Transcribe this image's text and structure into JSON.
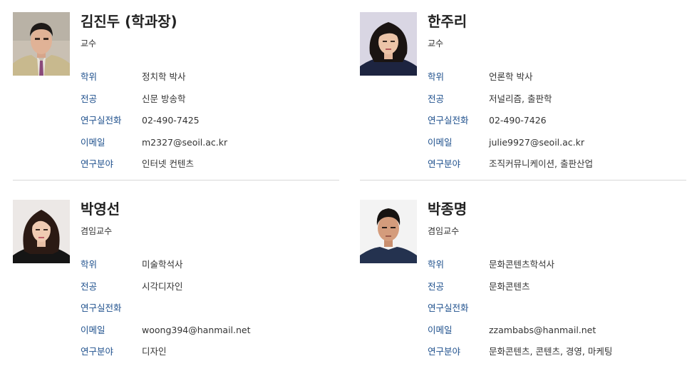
{
  "labels": {
    "degree": "학위",
    "major": "전공",
    "phone": "연구실전화",
    "email": "이메일",
    "field": "연구분야"
  },
  "professors": [
    {
      "name": "김진두 (학과장)",
      "position": "교수",
      "degree": "정치학 박사",
      "major": "신문 방송학",
      "phone": "02-490-7425",
      "email": "m2327@seoil.ac.kr",
      "field": "인터넷 컨텐츠"
    },
    {
      "name": "한주리",
      "position": "교수",
      "degree": "언론학 박사",
      "major": "저널리즘, 출판학",
      "phone": "02-490-7426",
      "email": "julie9927@seoil.ac.kr",
      "field": "조직커뮤니케이션, 출판산업"
    },
    {
      "name": "박영선",
      "position": "겸임교수",
      "degree": "미술학석사",
      "major": "시각디자인",
      "phone": "",
      "email": "woong394@hanmail.net",
      "field": "디자인"
    },
    {
      "name": "박종명",
      "position": "겸임교수",
      "degree": "문화콘텐츠학석사",
      "major": "문화콘텐츠",
      "phone": "",
      "email": "zzambabs@hanmail.net",
      "field": "문화콘텐츠, 콘텐츠, 경영, 마케팅"
    }
  ],
  "colors": {
    "label": "#1d4f8c",
    "divider": "#d9d9d9"
  }
}
